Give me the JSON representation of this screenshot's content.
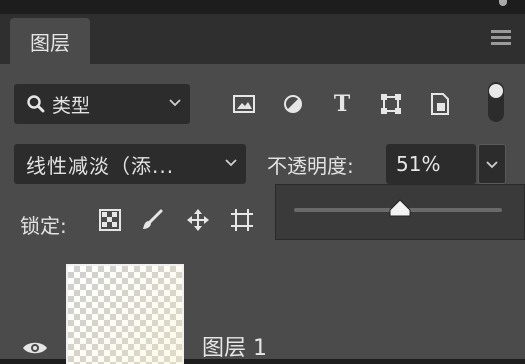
{
  "panel": {
    "tab_label": "图层"
  },
  "filter": {
    "kind_label": "类型",
    "icons": [
      "pixel-layer-filter-icon",
      "adjustment-layer-filter-icon",
      "type-layer-filter-icon",
      "shape-layer-filter-icon",
      "smart-object-filter-icon"
    ],
    "type_icon_glyph": "T"
  },
  "blend": {
    "mode_label": "线性减淡（添...",
    "opacity_label": "不透明度:",
    "opacity_value": "51%",
    "opacity_fraction": 0.51
  },
  "lock": {
    "label": "锁定:",
    "icons": [
      "lock-transparent-pixels-icon",
      "lock-image-pixels-icon",
      "lock-position-icon",
      "artboard-autonest-icon"
    ]
  },
  "layers": [
    {
      "name": "图层 1",
      "visible": true
    }
  ],
  "colors": {
    "panel_bg": "#4b4b4b",
    "tabbar_bg": "#2f2f2f",
    "field_bg": "#2c2c2c",
    "text": "#e2e2e2"
  }
}
